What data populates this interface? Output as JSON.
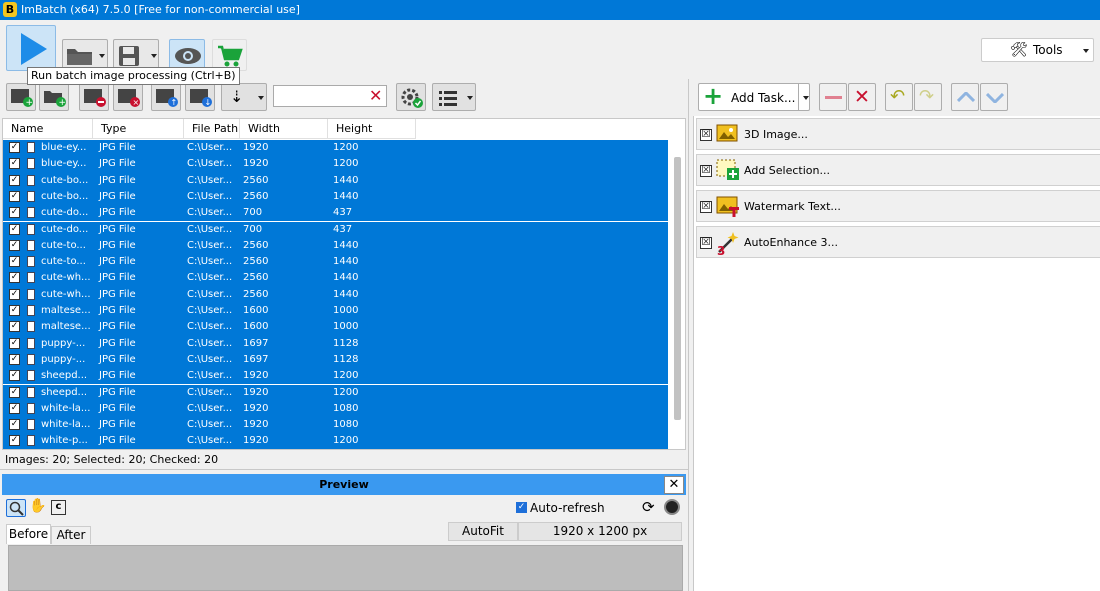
{
  "window": {
    "title": "ImBatch (x64) 7.5.0 [Free for non-commercial use]",
    "logo_letter": "B"
  },
  "toolbar": {
    "tools_label": "Tools",
    "tooltip": "Run batch image processing (Ctrl+B)"
  },
  "search": {
    "value": ""
  },
  "columns": [
    "Name",
    "Type",
    "File Path",
    "Width",
    "Height"
  ],
  "files": [
    {
      "name": "blue-ey...",
      "type": "JPG File",
      "path": "C:\\User...",
      "width": "1920",
      "height": "1200"
    },
    {
      "name": "blue-ey...",
      "type": "JPG File",
      "path": "C:\\User...",
      "width": "1920",
      "height": "1200"
    },
    {
      "name": "cute-bo...",
      "type": "JPG File",
      "path": "C:\\User...",
      "width": "2560",
      "height": "1440"
    },
    {
      "name": "cute-bo...",
      "type": "JPG File",
      "path": "C:\\User...",
      "width": "2560",
      "height": "1440"
    },
    {
      "name": "cute-do...",
      "type": "JPG File",
      "path": "C:\\User...",
      "width": "700",
      "height": "437"
    },
    {
      "name": "cute-do...",
      "type": "JPG File",
      "path": "C:\\User...",
      "width": "700",
      "height": "437"
    },
    {
      "name": "cute-to...",
      "type": "JPG File",
      "path": "C:\\User...",
      "width": "2560",
      "height": "1440"
    },
    {
      "name": "cute-to...",
      "type": "JPG File",
      "path": "C:\\User...",
      "width": "2560",
      "height": "1440"
    },
    {
      "name": "cute-wh...",
      "type": "JPG File",
      "path": "C:\\User...",
      "width": "2560",
      "height": "1440"
    },
    {
      "name": "cute-wh...",
      "type": "JPG File",
      "path": "C:\\User...",
      "width": "2560",
      "height": "1440"
    },
    {
      "name": "maltese...",
      "type": "JPG File",
      "path": "C:\\User...",
      "width": "1600",
      "height": "1000"
    },
    {
      "name": "maltese...",
      "type": "JPG File",
      "path": "C:\\User...",
      "width": "1600",
      "height": "1000"
    },
    {
      "name": "puppy-...",
      "type": "JPG File",
      "path": "C:\\User...",
      "width": "1697",
      "height": "1128"
    },
    {
      "name": "puppy-...",
      "type": "JPG File",
      "path": "C:\\User...",
      "width": "1697",
      "height": "1128"
    },
    {
      "name": "sheepd...",
      "type": "JPG File",
      "path": "C:\\User...",
      "width": "1920",
      "height": "1200"
    },
    {
      "name": "sheepd...",
      "type": "JPG File",
      "path": "C:\\User...",
      "width": "1920",
      "height": "1200"
    },
    {
      "name": "white-la...",
      "type": "JPG File",
      "path": "C:\\User...",
      "width": "1920",
      "height": "1080"
    },
    {
      "name": "white-la...",
      "type": "JPG File",
      "path": "C:\\User...",
      "width": "1920",
      "height": "1080"
    },
    {
      "name": "white-p...",
      "type": "JPG File",
      "path": "C:\\User...",
      "width": "1920",
      "height": "1200"
    }
  ],
  "status": "Images: 20; Selected: 20; Checked: 20",
  "preview": {
    "title": "Preview",
    "auto_refresh_label": "Auto-refresh",
    "tab_before": "Before",
    "tab_after": "After",
    "autofit_label": "AutoFit",
    "dimensions": "1920 x 1200 px"
  },
  "tasks_toolbar": {
    "add_task_label": "Add Task..."
  },
  "tasks": [
    {
      "label": "3D Image..."
    },
    {
      "label": "Add Selection..."
    },
    {
      "label": "Watermark Text..."
    },
    {
      "label": "AutoEnhance 3..."
    }
  ],
  "colors": {
    "selection": "#0078d7",
    "titlebar": "#0078d7",
    "preview_bar": "#3a99f0",
    "accent_green": "#1aa33a",
    "delete_red": "#c8102e"
  }
}
